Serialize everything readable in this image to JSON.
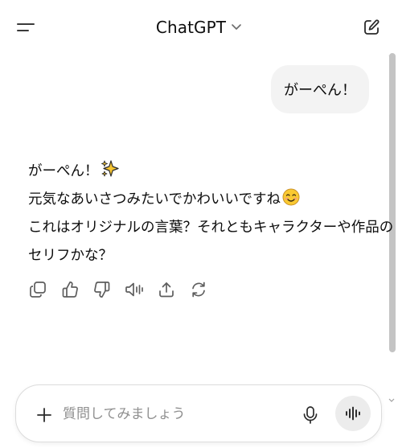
{
  "header": {
    "title": "ChatGPT",
    "menu_icon": "sidebar-toggle-icon",
    "dropdown_icon": "chevron-down-icon",
    "new_chat_icon": "edit-icon"
  },
  "conversation": {
    "user_message": "がーぺん！",
    "assistant_lines": [
      "がーぺん！",
      "元気なあいさつみたいでかわいいですね",
      "これはオリジナルの言葉？それともキャラクターや作品の",
      "セリフかな？"
    ],
    "emojis": [
      "sparkles",
      "smiling-face-with-smiling-eyes"
    ],
    "actions": [
      "copy-icon",
      "thumbs-up-icon",
      "thumbs-down-icon",
      "read-aloud-icon",
      "share-icon",
      "regenerate-icon"
    ]
  },
  "composer": {
    "placeholder": "質問してみましょう",
    "value": ""
  },
  "colors": {
    "user_bubble": "#f3f3f3",
    "text": "#0d0d0d",
    "icon": "#5d5d5d",
    "placeholder": "#8f8f8f",
    "voice_button": "#ececec"
  }
}
